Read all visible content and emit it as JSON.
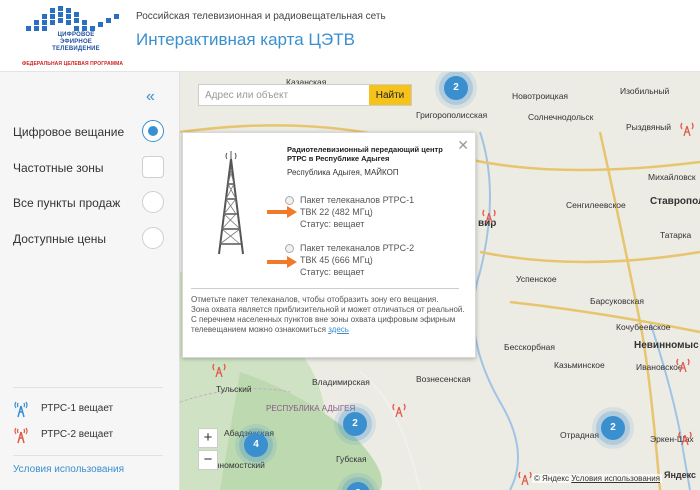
{
  "header": {
    "logo_line1": "ЦИФРОВОЕ",
    "logo_line2": "ЭФИРНОЕ",
    "logo_line3": "ТЕЛЕВИДЕНИЕ",
    "logo_program": "ФЕДЕРАЛЬНАЯ ЦЕЛЕВАЯ ПРОГРАММА",
    "network_title": "Российская телевизионная и радиовещательная сеть",
    "map_title": "Интерактивная карта ЦЭТВ"
  },
  "sidebar": {
    "collapse_glyph": "«",
    "items": [
      {
        "label": "Цифровое вещание",
        "selected": true
      },
      {
        "label": "Частотные зоны",
        "selected": false
      },
      {
        "label": "Все пункты продаж",
        "selected": false
      },
      {
        "label": "Доступные цены",
        "selected": false
      }
    ],
    "legend": [
      {
        "label": "РТРС-1 вещает",
        "color": "#3a8fcf"
      },
      {
        "label": "РТРС-2 вещает",
        "color": "#e05a4a"
      }
    ],
    "terms_link": "Условия использования"
  },
  "search": {
    "placeholder": "Адрес или объект",
    "button": "Найти"
  },
  "map": {
    "places": [
      {
        "name": "Казанская"
      },
      {
        "name": "Новотроицкая"
      },
      {
        "name": "Изобильный"
      },
      {
        "name": "Григорополисская"
      },
      {
        "name": "Солнечнодольск"
      },
      {
        "name": "Рыздвяный"
      },
      {
        "name": "Михайловск"
      },
      {
        "name": "Сенгилеевское"
      },
      {
        "name": "Ставропол"
      },
      {
        "name": "Татарка"
      },
      {
        "name": "вир"
      },
      {
        "name": "Успенское"
      },
      {
        "name": "Барсуковская"
      },
      {
        "name": "Кочубеевское"
      },
      {
        "name": "Бесскорбная"
      },
      {
        "name": "Невинномыс"
      },
      {
        "name": "Казьминское"
      },
      {
        "name": "Ивановское"
      },
      {
        "name": "Тульский"
      },
      {
        "name": "Владимирская"
      },
      {
        "name": "Вознесенская"
      },
      {
        "name": "РЕСПУБЛИКА АДЫГЕЯ"
      },
      {
        "name": "Абадзехская"
      },
      {
        "name": "енномостский"
      },
      {
        "name": "Губская"
      },
      {
        "name": "Отрадная"
      },
      {
        "name": "Эркен-Шах"
      }
    ],
    "clusters": [
      "2",
      "2",
      "2",
      "4",
      "2"
    ],
    "zoom_in": "+",
    "zoom_out": "−",
    "copyright": "© Яндекс",
    "copyright_link": "Условия использования",
    "yandex": "Яндекс"
  },
  "popup": {
    "title": "Радиотелевизионный передающий центр РТРС в Республике Адыгея",
    "address": "Республика Адыгея, МАЙКОП",
    "close": "✕",
    "packages": [
      {
        "name": "Пакет телеканалов РТРС-1",
        "channel": "ТВК 22 (482 МГц)",
        "status": "Статус: вещает"
      },
      {
        "name": "Пакет телеканалов РТРС-2",
        "channel": "ТВК 45 (666 МГц)",
        "status": "Статус: вещает"
      }
    ],
    "note_1": "Отметьте пакет телеканалов, чтобы отобразить зону его вещания.",
    "note_2": "Зона охвата является приблизительной и может отличаться от реальной.",
    "note_3": "С перечнем населенных пунктов вне зоны охвата цифровым эфирным телевещанием можно ознакомиться",
    "note_link": "здесь"
  }
}
